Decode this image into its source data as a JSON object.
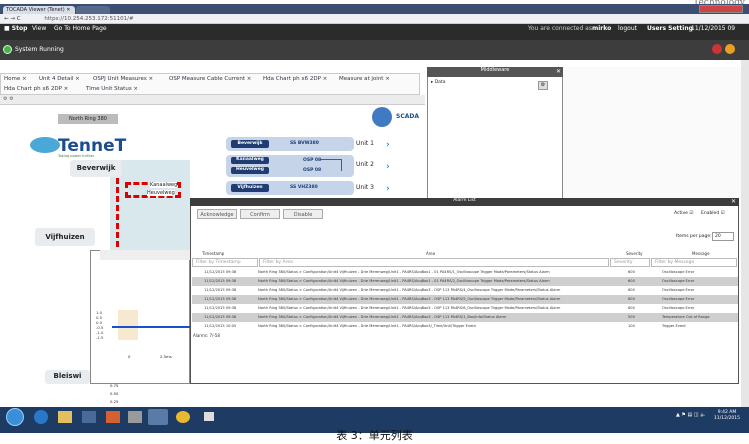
{
  "corner": "Technology",
  "browser": {
    "tab_title": "TOCADA Viewer (Tenet) ✕",
    "url": "https://10.254.253.172:51101/#"
  },
  "menu": {
    "stop": "Stop",
    "view": "View",
    "home": "Go To Home Page",
    "connected": "You are connected as",
    "user": "mirko",
    "logout": "logout",
    "settings": "Users Setting",
    "date": "11/12/2015 09"
  },
  "status": {
    "label": "System Running"
  },
  "tabs": [
    "Home ×",
    "Unit 4 Detail ×",
    "OSPJ Unit Measures ×",
    "OSP Measure Cable Current ×",
    "Hda Chart ph x6 2DP ×",
    "Measure at joint ×",
    "Hda Chart ph x6 2DP ×",
    "Time Unit Status ×"
  ],
  "map": {
    "ring": "North Ring 380",
    "scada": "SCADA",
    "brand": "TenneT",
    "brand_sub": "Taking power further",
    "beverwijk": "Beverwijk",
    "vijfhuizen": "Vijfhuizen",
    "bleiswijk": "Bleiswi",
    "kanaalweg": "Kanaalweg",
    "heuvelweg": "Heuvelweg",
    "units": [
      {
        "name": "Beverwijk",
        "code": "SS BVW380",
        "unit": "Unit 1"
      },
      {
        "name": "Kanaalweg",
        "code": "OSP 08",
        "unit": "Unit 2"
      },
      {
        "name": "Heuvelweg",
        "code": "OSP 08",
        "unit": ""
      },
      {
        "name": "Vijfhuizen",
        "code": "SS VHZ380",
        "unit": "Unit 3"
      }
    ]
  },
  "middleware": {
    "title": "Middleware",
    "item": "Data"
  },
  "alarm": {
    "title": "Alarm List",
    "ack": "Acknowledge",
    "confirm": "Confirm",
    "disable": "Disable",
    "active": "Active",
    "enabled": "Enabled",
    "items_per_page_label": "Items per page:",
    "items_per_page": "20",
    "cols": {
      "ts": "Timestamp",
      "area": "Area",
      "sev": "Severity",
      "msg": "Message"
    },
    "filters": {
      "ts": "Filter by Timestamp",
      "area": "Filter by Area",
      "sev": "Severity",
      "msg": "Filter by Message"
    },
    "rows": [
      {
        "ts": "11/12/2015 09:38",
        "area": "North Ring 380/Status > Configuration/Unit4 Vijfhuizen - Drie Merenweg/Unit1 - PA4RS/AcqBox1 - 01 PA4RS/1_Oscilloscope Trigger Mode/Parameters/Status Alarm",
        "sev": "600",
        "msg": "Oscilloscope Error"
      },
      {
        "ts": "11/12/2015 09:38",
        "area": "North Ring 380/Status > Configuration/Unit4 Vijfhuizen - Drie Merenweg/Unit1 - PA4RS/AcqBox1 - 01 PA4RS/2_Oscilloscope Trigger Mode/Parameters/Status Alarm",
        "sev": "600",
        "msg": "Oscilloscope Error"
      },
      {
        "ts": "11/12/2015 09:38",
        "area": "North Ring 380/Status > Configuration/Unit4 Vijfhuizen - Drie Merenweg/Unit1 - PA4RS/AcqBox3 - OSP 113 PA4RS/4_Oscilloscope Trigger Mode/Parameters/Status Alarm",
        "sev": "600",
        "msg": "Oscilloscope Error"
      },
      {
        "ts": "11/12/2015 09:38",
        "area": "North Ring 380/Status > Configuration/Unit4 Vijfhuizen - Drie Merenweg/Unit1 - PA4RS/AcqBox3 - OSP 113 PA4RS/5_Oscilloscope Trigger Mode/Parameters/Status Alarm",
        "sev": "600",
        "msg": "Oscilloscope Error"
      },
      {
        "ts": "11/12/2015 09:38",
        "area": "North Ring 380/Status > Configuration/Unit4 Vijfhuizen - Drie Merenweg/Unit1 - PA4RS/AcqBox3 - OSP 113 PA4RS/6_Oscilloscope Trigger Mode/Parameters/Status Alarm",
        "sev": "600",
        "msg": "Oscilloscope Error"
      },
      {
        "ts": "11/12/2015 09:38",
        "area": "North Ring 380/Status > Configuration/Unit4 Vijfhuizen - Drie Merenweg/Unit1 - PA4RS/AcqBox3 - OSP 113 PA4RS/1_Box/Info/Status Alarm",
        "sev": "500",
        "msg": "Temperature Out of Range"
      },
      {
        "ts": "11/12/2015 10:05",
        "area": "North Ring 380/Status > Configuration/Unit4 Vijfhuizen - Drie Merenweg/Unit1 - PA4RS/AcqBox3/_Time/Unit/Trigger Event",
        "sev": "100",
        "msg": "Trigger Event"
      }
    ],
    "footer": "Alarms: 7/-58"
  },
  "chart": {
    "ticks": [
      "1.0",
      "0.5",
      "0.0",
      "-0.5",
      "-1.0",
      "-1.5"
    ],
    "x0": "0",
    "x1": "2.5ms",
    "lower": [
      "0.75",
      "0.50",
      "0.25"
    ]
  },
  "taskbar": {
    "time": "9:42 AM",
    "date": "11/12/2015"
  },
  "caption": "表 3：单元列表"
}
